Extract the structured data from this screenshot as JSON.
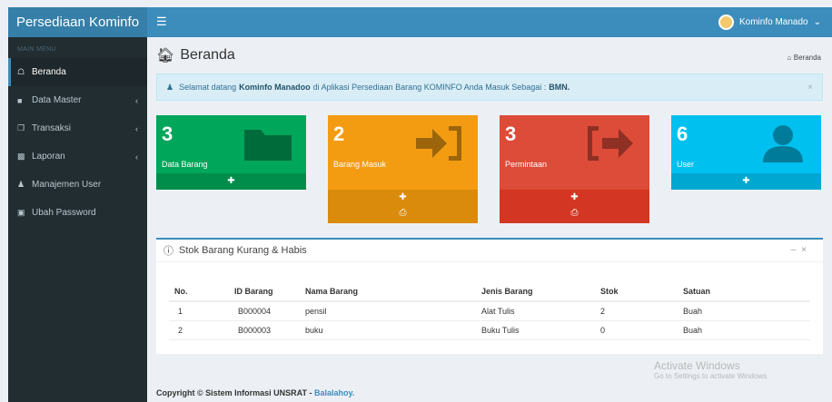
{
  "app": {
    "title": "Persediaan Kominfo"
  },
  "sidebar": {
    "header": "MAIN MENU",
    "items": [
      {
        "label": "Beranda",
        "icon": "home-icon"
      },
      {
        "label": "Data Master",
        "icon": "folder-icon"
      },
      {
        "label": "Transaksi",
        "icon": "copy-icon"
      },
      {
        "label": "Laporan",
        "icon": "file-icon"
      },
      {
        "label": "Manajemen User",
        "icon": "user-icon"
      },
      {
        "label": "Ubah Password",
        "icon": "lock-icon"
      }
    ]
  },
  "topbar": {
    "user_name": "Kominfo Manado"
  },
  "page": {
    "title": "Beranda",
    "breadcrumb": "Beranda"
  },
  "alert": {
    "prefix": "Selamat datang",
    "name": "Kominfo Manadoo",
    "middle": "di Aplikasi Persediaan Barang KOMINFO Anda Masuk Sebagai :",
    "role": "BMN."
  },
  "stats": [
    {
      "value": "3",
      "label": "Data Barang",
      "color": "#00a65a",
      "foot": "#008d4c"
    },
    {
      "value": "2",
      "label": "Barang Masuk",
      "color": "#f39c12",
      "foot": "#db8b0b"
    },
    {
      "value": "3",
      "label": "Permintaan",
      "color": "#dd4b39",
      "foot": "#d33724"
    },
    {
      "value": "6",
      "label": "User",
      "color": "#00c0ef",
      "foot": "#00a7d0"
    }
  ],
  "panel": {
    "title": "Stok Barang Kurang & Habis",
    "headers": [
      "No.",
      "ID Barang",
      "Nama Barang",
      "Jenis Barang",
      "Stok",
      "Satuan"
    ],
    "rows": [
      [
        "1",
        "B000004",
        "pensil",
        "Alat Tulis",
        "2",
        "Buah"
      ],
      [
        "2",
        "B000003",
        "buku",
        "Buku Tulis",
        "0",
        "Buah"
      ]
    ]
  },
  "footer": {
    "text": "Copyright © Sistem Informasi UNSRAT -",
    "link": "Balalahoy."
  },
  "watermark": {
    "title": "Activate Windows",
    "subtitle": "Go to Settings to activate Windows."
  }
}
